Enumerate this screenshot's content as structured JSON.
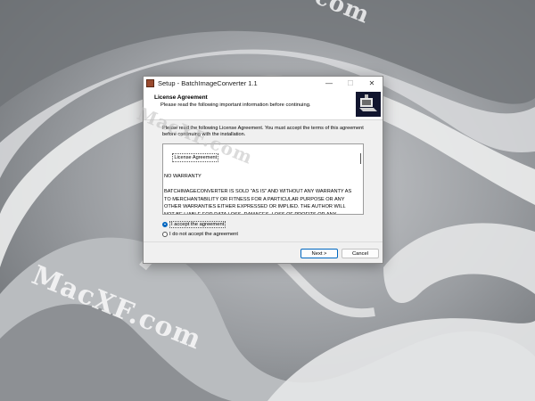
{
  "window": {
    "title": "Setup - BatchImageConverter 1.1",
    "controls": {
      "minimize": "—",
      "maximize": "☐",
      "close": "✕"
    }
  },
  "header": {
    "title": "License Agreement",
    "subtitle": "Please read the following important information before continuing."
  },
  "body": {
    "intro": "Please read the following License Agreement. You must accept the terms of this agreement before continuing with the installation.",
    "license": {
      "heading": "License Agreement",
      "text": "NO WARRANTY\n\nBATCHIMAGECONVERTER IS SOLD \"AS IS\" AND WITHOUT ANY WARRANTY AS TO MERCHANTABILITY OR FITNESS FOR A PARTICULAR PURPOSE OR ANY OTHER WARRANTIES EITHER EXPRESSED OR IMPLIED. THE AUTHOR WILL NOT BE LIABLE FOR DATA LOSS, DAMAGES, LOSS OF PROFITS OR ANY OTHER KIND OF LOSS WHILE USING OR MISUSING THIS SOFTWARE."
    },
    "radio_accept": "I accept the agreement",
    "radio_decline": "I do not accept the agreement",
    "selected": "accept"
  },
  "buttons": {
    "next": "Next >",
    "cancel": "Cancel"
  },
  "watermarks": {
    "top": "com",
    "dialog": "MacXF.com",
    "bottom": "MacXF.com"
  },
  "colors": {
    "accent": "#0067c0",
    "logo_bg": "#11152e"
  }
}
